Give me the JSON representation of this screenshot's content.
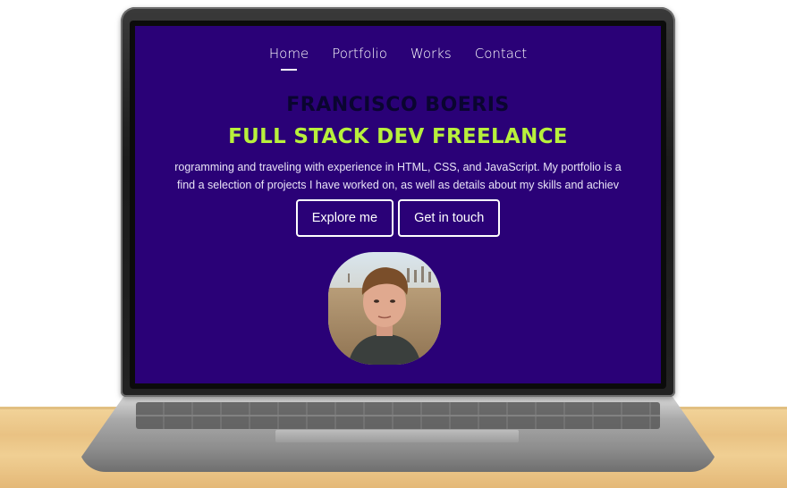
{
  "nav": {
    "items": [
      {
        "label": "Home"
      },
      {
        "label": "Portfolio"
      },
      {
        "label": "Works"
      },
      {
        "label": "Contact"
      }
    ]
  },
  "hero": {
    "name": "FRANCISCO BOERIS",
    "role": "FULL STACK DEV FREELANCE",
    "bio_line1": "rogramming and traveling with experience in HTML, CSS, and JavaScript. My portfolio is a",
    "bio_line2": "find a selection of projects I have worked on, as well as details about my skills and achiev",
    "explore_label": "Explore me",
    "contact_label": "Get in touch"
  },
  "colors": {
    "screen_bg": "#2a0177",
    "accent": "#b8f03c",
    "name_color": "#0a0530"
  },
  "icons": {
    "avatar": "profile-photo"
  }
}
